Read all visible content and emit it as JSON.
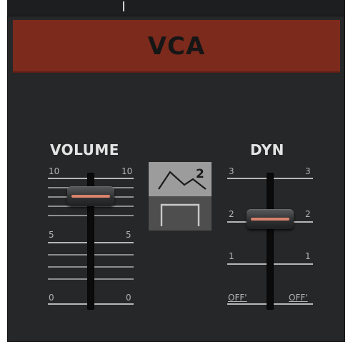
{
  "module": {
    "title": "VCA"
  },
  "volume": {
    "label": "VOLUME",
    "scale": {
      "top": "10",
      "mid": "5",
      "bottom": "0"
    },
    "level": 0.85
  },
  "dyn": {
    "label": "DYN",
    "scale": {
      "top": "3",
      "upper": "2",
      "lower": "1",
      "bottom": "OFF'"
    },
    "level": 0.67
  },
  "envelope_selector": {
    "selected": "env-2",
    "options": [
      {
        "name": "env-2",
        "icon": "adsr-envelope-icon",
        "label": "2"
      },
      {
        "name": "gate",
        "icon": "gate-envelope-icon"
      }
    ]
  }
}
